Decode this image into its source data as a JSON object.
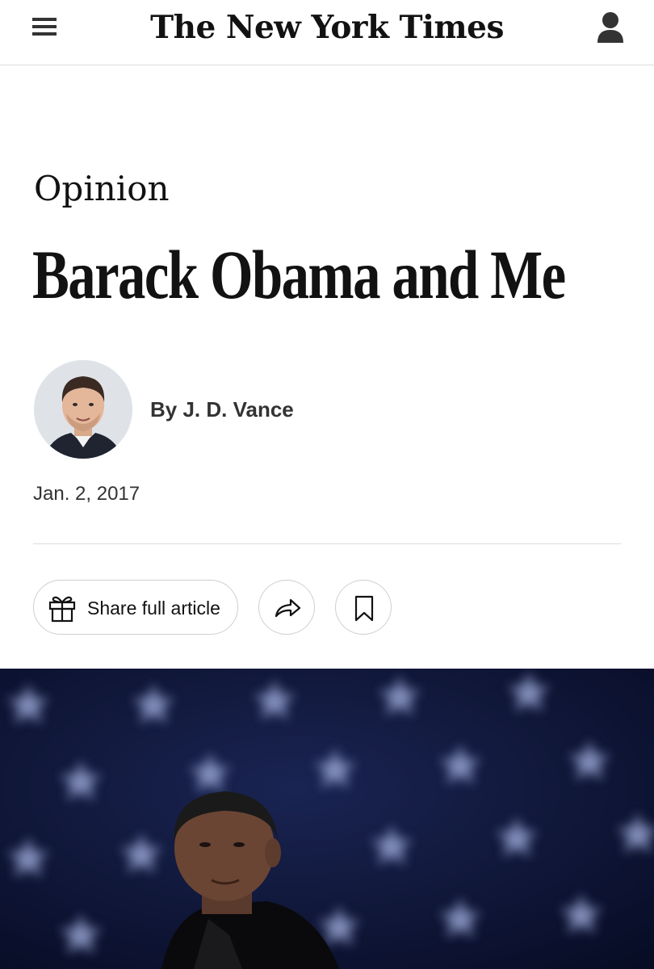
{
  "header": {
    "logo": "The New York Times",
    "menu_icon": "hamburger-menu-icon",
    "account_icon": "user-account-icon"
  },
  "article": {
    "kicker": "Opinion",
    "headline": "Barack Obama and Me",
    "byline": "By J. D. Vance",
    "date": "Jan. 2, 2017"
  },
  "actions": {
    "share_full_label": "Share full article",
    "gift_icon": "gift-icon",
    "share_icon": "share-arrow-icon",
    "save_icon": "bookmark-icon"
  },
  "colors": {
    "text": "#121212",
    "secondary_text": "#333333",
    "divider": "#dcdcdc",
    "hero_background": "#0b1436"
  }
}
